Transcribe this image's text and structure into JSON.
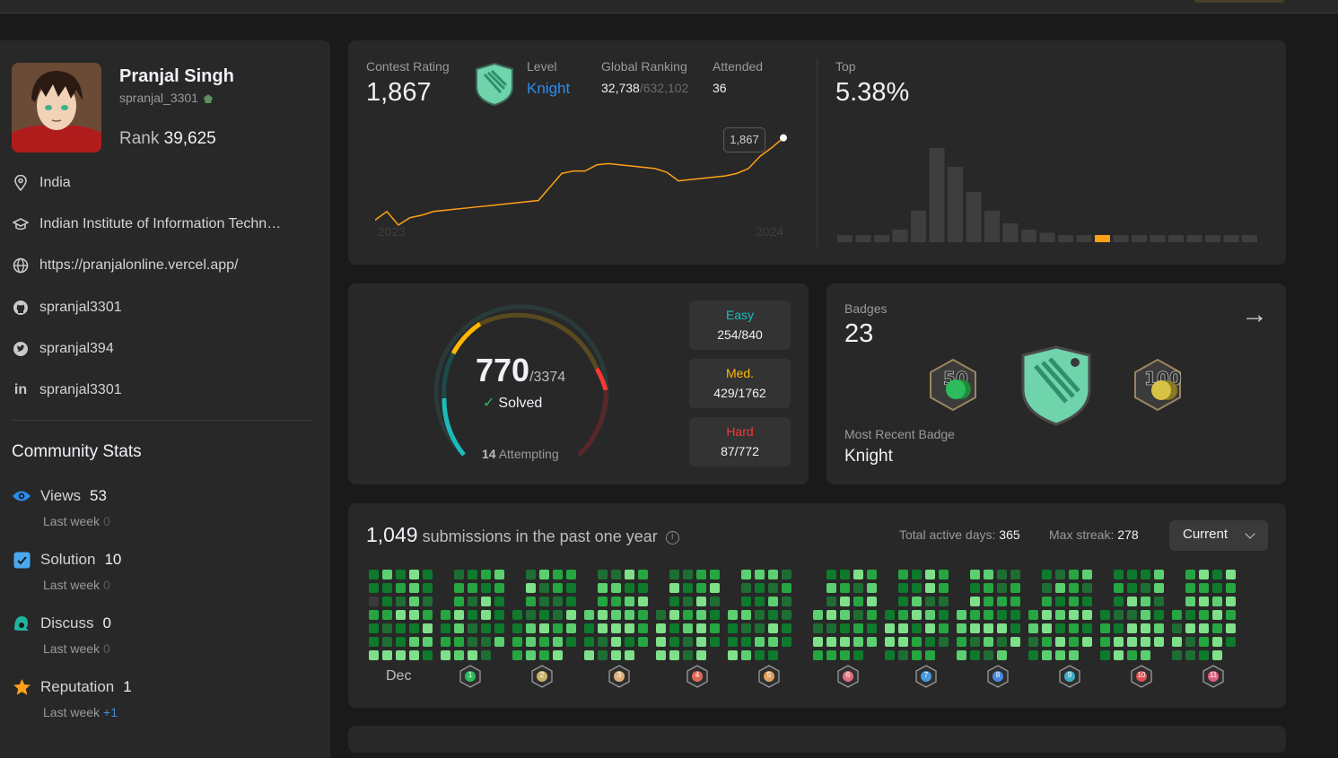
{
  "profile": {
    "name": "Pranjal Singh",
    "handle": "spranjal_3301",
    "rank_label": "Rank",
    "rank_value": "39,625"
  },
  "info": {
    "location": "India",
    "school": "Indian Institute of Information Techn…",
    "website": "https://pranjalonline.vercel.app/",
    "github": "spranjal3301",
    "twitter": "spranjal394",
    "linkedin": "spranjal3301"
  },
  "community": {
    "title": "Community Stats",
    "views": {
      "label": "Views",
      "value": "53",
      "lw_label": "Last week",
      "lw_value": "0"
    },
    "solution": {
      "label": "Solution",
      "value": "10",
      "lw_label": "Last week",
      "lw_value": "0"
    },
    "discuss": {
      "label": "Discuss",
      "value": "0",
      "lw_label": "Last week",
      "lw_value": "0"
    },
    "reputation": {
      "label": "Reputation",
      "value": "1",
      "lw_label": "Last week",
      "lw_value": "+1"
    }
  },
  "contest": {
    "rating_label": "Contest Rating",
    "rating": "1,867",
    "level_label": "Level",
    "level": "Knight",
    "global_label": "Global Ranking",
    "global_rank": "32,738",
    "global_total": "/632,102",
    "attended_label": "Attended",
    "attended": "36",
    "top_label": "Top",
    "top": "5.38%",
    "tooltip": "1,867",
    "year_start": "2023",
    "year_end": "2024",
    "rating_history": [
      1838,
      1845,
      1834,
      1840,
      1842,
      1845,
      1846,
      1847,
      1848,
      1849,
      1850,
      1851,
      1852,
      1853,
      1854,
      1865,
      1876,
      1878,
      1878,
      1883,
      1884,
      1883,
      1882,
      1881,
      1880,
      1877,
      1870,
      1871,
      1872,
      1873,
      1874,
      1876,
      1880,
      1890,
      1897,
      1905
    ],
    "histogram": [
      1,
      1,
      1,
      2,
      5,
      15,
      12,
      8,
      5,
      3,
      2,
      1.5,
      1,
      1,
      1,
      1,
      1,
      1,
      1,
      1,
      1,
      1,
      1
    ],
    "histogram_highlight_index": 14
  },
  "solved": {
    "count": "770",
    "total": "/3374",
    "solved_label": "Solved",
    "attempting_count": "14",
    "attempting_label": "Attempting",
    "easy": {
      "label": "Easy",
      "value": "254/840",
      "color": "#1cbaba"
    },
    "medium": {
      "label": "Med.",
      "value": "429/1762",
      "color": "#ffb700"
    },
    "hard": {
      "label": "Hard",
      "value": "87/772",
      "color": "#f63737"
    }
  },
  "badges": {
    "label": "Badges",
    "count": "23",
    "recent_label": "Most Recent Badge",
    "recent": "Knight"
  },
  "submissions": {
    "count": "1,049",
    "text": "submissions in the past one year",
    "active_label": "Total active days:",
    "active_value": "365",
    "streak_label": "Max streak:",
    "streak_value": "278",
    "dropdown": "Current",
    "first_month": "Dec",
    "month_badges": [
      "1",
      "2",
      "3",
      "4",
      "5",
      "6",
      "7",
      "8",
      "9",
      "10",
      "11"
    ]
  },
  "colors": {
    "accent": "#2d8cf0",
    "graph_line": "#ffa116",
    "green_light": "#7fe08a",
    "green_mid": "#26a641",
    "green_dark": "#0e7a2c"
  }
}
